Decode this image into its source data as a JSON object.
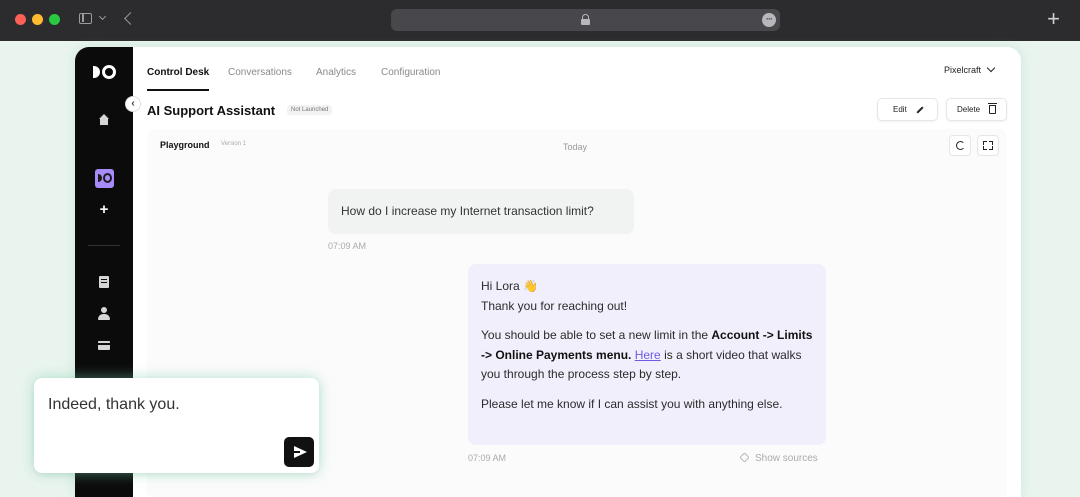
{
  "browser": {
    "new_tab_label": "+"
  },
  "sidebar": {
    "collapse_label": "‹",
    "items": [
      {
        "icon": "home-icon"
      },
      {
        "icon": "assistant-icon",
        "active": true
      },
      {
        "icon": "plus-icon",
        "label": "+"
      },
      {
        "icon": "document-icon"
      },
      {
        "icon": "user-icon"
      },
      {
        "icon": "card-icon"
      }
    ]
  },
  "tabs": [
    {
      "label": "Control Desk",
      "active": true
    },
    {
      "label": "Conversations"
    },
    {
      "label": "Analytics"
    },
    {
      "label": "Configuration"
    }
  ],
  "workspace": {
    "name": "Pixelcraft"
  },
  "header": {
    "title": "AI Support Assistant",
    "status": "Not Launched",
    "edit_label": "Edit",
    "delete_label": "Delete"
  },
  "playground": {
    "title": "Playground",
    "version": "Version 1",
    "date": "Today"
  },
  "messages": {
    "user": {
      "text": "How do I increase my Internet transaction limit?",
      "time": "07:09 AM"
    },
    "bot": {
      "greeting": "Hi Lora 👋",
      "thanks": "Thank you for reaching out!",
      "p2_a": "You should be able to set a new limit in the ",
      "p2_bold": "Account -> Limits -> Online Payments menu.",
      "p2_link": "Here",
      "p2_b": " is a short video that walks you through the process step by step.",
      "p3": "Please let me know if I can assist you with anything else.",
      "time": "07:09 AM",
      "sources_label": "Show sources"
    }
  },
  "composer": {
    "value": "Indeed, thank you."
  },
  "colors": {
    "accent": "#a78bfa",
    "link": "#6d5ce7",
    "bot_bubble": "#f1effc",
    "user_bubble": "#f1f2f2",
    "sidebar": "#0b0b0c"
  }
}
